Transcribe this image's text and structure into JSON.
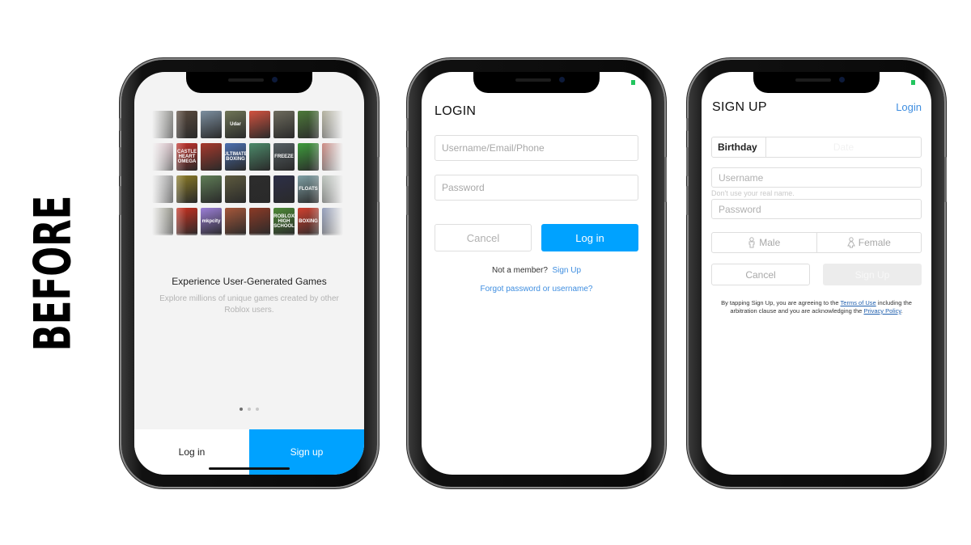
{
  "overlay_label": "BEFORE",
  "colors": {
    "brand_blue": "#00a2ff",
    "link_blue": "#3f8ee0",
    "battery_green": "#22c55e"
  },
  "phone1": {
    "games": [
      {
        "label": "",
        "color": "#6b6b63"
      },
      {
        "label": "",
        "color": "#5a4a3e"
      },
      {
        "label": "",
        "color": "#7c8fa0"
      },
      {
        "label": "Udar",
        "color": "#6f7557"
      },
      {
        "label": "",
        "color": "#d2523f"
      },
      {
        "label": "",
        "color": "#6d6b5d"
      },
      {
        "label": "",
        "color": "#4d7a3a"
      },
      {
        "label": "",
        "color": "#8d8a6a"
      },
      {
        "label": "",
        "color": "#d6a7b5"
      },
      {
        "label": "CASTLE HEART OMEGA",
        "color": "#c4312b"
      },
      {
        "label": "",
        "color": "#a8392c"
      },
      {
        "label": "ULTIMATE BOXING",
        "color": "#4b6fb0"
      },
      {
        "label": "",
        "color": "#4c8a6a"
      },
      {
        "label": "FREEZE",
        "color": "#566064"
      },
      {
        "label": "",
        "color": "#3e9c3c"
      },
      {
        "label": "",
        "color": "#b84a3e"
      },
      {
        "label": "",
        "color": "#7b7b7b"
      },
      {
        "label": "",
        "color": "#8a7a26"
      },
      {
        "label": "",
        "color": "#5f7d56"
      },
      {
        "label": "",
        "color": "#5d5a3e"
      },
      {
        "label": "",
        "color": "#2c2c2c"
      },
      {
        "label": "",
        "color": "#2d2f48"
      },
      {
        "label": "FLOATS",
        "color": "#7fa1a6"
      },
      {
        "label": "",
        "color": "#9aa79b"
      },
      {
        "label": "",
        "color": "#6a6a52"
      },
      {
        "label": "",
        "color": "#c9301f"
      },
      {
        "label": "mkpcity",
        "color": "#9c7fd8"
      },
      {
        "label": "",
        "color": "#a6573a"
      },
      {
        "label": "",
        "color": "#8c3a26"
      },
      {
        "label": "ROBLOX HIGH SCHOOL",
        "color": "#4d8a36"
      },
      {
        "label": "BOXING",
        "color": "#d1402f"
      },
      {
        "label": "",
        "color": "#5a6a9a"
      }
    ],
    "title": "Experience User-Generated Games",
    "subtitle": "Explore millions of unique games created by other Roblox users.",
    "pagination": {
      "count": 3,
      "active": 0
    },
    "login_label": "Log in",
    "signup_label": "Sign up"
  },
  "phone2": {
    "title": "LOGIN",
    "username_placeholder": "Username/Email/Phone",
    "password_placeholder": "Password",
    "cancel_label": "Cancel",
    "login_label": "Log in",
    "not_member_text": "Not a member?",
    "signup_link": "Sign Up",
    "forgot_link": "Forgot password or username?"
  },
  "phone3": {
    "title": "SIGN UP",
    "login_link": "Login",
    "birthday_label": "Birthday",
    "birthday_value": "Date",
    "username_placeholder": "Username",
    "username_hint": "Don't use your real name.",
    "password_placeholder": "Password",
    "gender_options": [
      {
        "label": "Male",
        "icon": "male-icon"
      },
      {
        "label": "Female",
        "icon": "female-icon"
      }
    ],
    "cancel_label": "Cancel",
    "signup_label": "Sign Up",
    "legal": {
      "part1": "By tapping Sign Up, you are agreeing to the ",
      "terms_link": "Terms of Use",
      "part2": " including the arbitration clause and you are acknowledging the ",
      "privacy_link": "Privacy Policy",
      "part3": "."
    }
  }
}
